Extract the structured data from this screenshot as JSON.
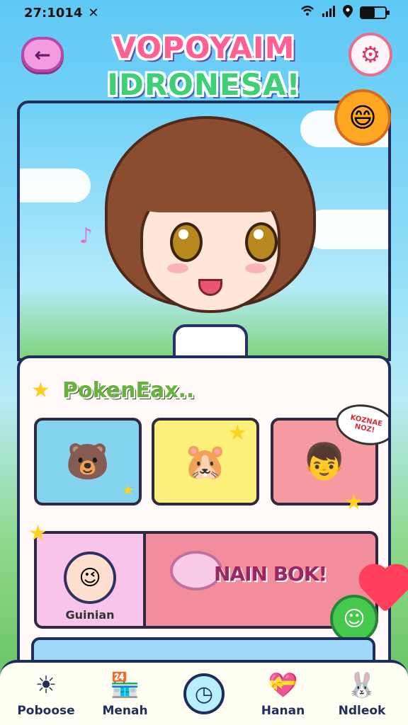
{
  "status_bar": {
    "time": "27:1014",
    "close_symbol": "✕",
    "icons": [
      "wifi-icon",
      "signal-icon",
      "location-icon",
      "battery-icon"
    ],
    "battery_level": 0.55
  },
  "header": {
    "logo_line1": "VOPOYAIM",
    "logo_line2": "IDRONESA!",
    "back_icon": "back-arrow-icon",
    "settings_icon": "gear-icon"
  },
  "hero": {
    "character_name": "",
    "decoration_icons": [
      "music-note-icon",
      "smiley-icon"
    ]
  },
  "content": {
    "section_title": "PokenEax..",
    "cards": [
      {
        "id": "card-1",
        "icon": "bear-character-icon"
      },
      {
        "id": "card-2",
        "icon": "pink-pet-icon"
      },
      {
        "id": "card-3",
        "icon": "boy-character-icon"
      }
    ],
    "speech_bubble": "KOZNAE\nNOZ!",
    "banner": {
      "avatar_name": "Guinian",
      "label": "NAIN BOK!"
    }
  },
  "bottom_nav": {
    "items": [
      {
        "label": "Poboose",
        "icon": "sun-icon"
      },
      {
        "label": "Menah",
        "icon": "shop-icon"
      },
      {
        "label": "",
        "icon": "clock-icon"
      },
      {
        "label": "Hanan",
        "icon": "heart-box-icon"
      },
      {
        "label": "Ndleok",
        "icon": "character-icon"
      }
    ]
  },
  "colors": {
    "accent_pink": "#f39be0",
    "accent_green": "#68b03f",
    "dark_outline": "#1f2d5a",
    "sky_blue": "#6fd0f8"
  }
}
